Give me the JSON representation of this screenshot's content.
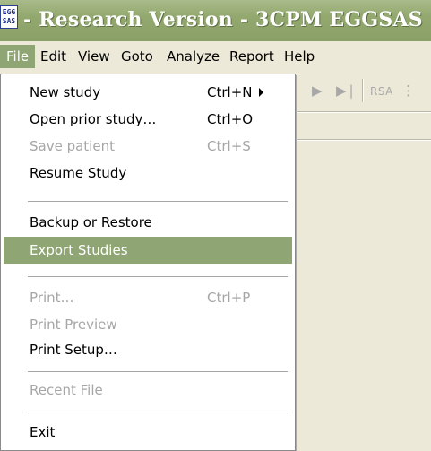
{
  "window": {
    "logo_line1": "EGG",
    "logo_line2": "SAS",
    "title": "- Research Version - 3CPM EGGSAS"
  },
  "menubar": {
    "items": [
      "File",
      "Edit",
      "View",
      "Goto",
      "Analyze",
      "Report",
      "Help"
    ],
    "active": "File"
  },
  "toolbar": {
    "rsa_label": "RSA"
  },
  "file_menu": {
    "new_study": {
      "label": "New study",
      "shortcut": "Ctrl+N"
    },
    "open_prior_study": {
      "label": "Open prior study…",
      "shortcut": "Ctrl+O"
    },
    "save_patient": {
      "label": "Save patient",
      "shortcut": "Ctrl+S",
      "disabled": true
    },
    "resume_study": {
      "label": "Resume Study"
    },
    "backup_restore": {
      "label": "Backup or Restore"
    },
    "export_studies": {
      "label": "Export Studies",
      "selected": true
    },
    "print": {
      "label": "Print…",
      "shortcut": "Ctrl+P",
      "disabled": true
    },
    "print_preview": {
      "label": "Print Preview",
      "disabled": true
    },
    "print_setup": {
      "label": "Print Setup…"
    },
    "recent_file": {
      "label": "Recent File",
      "disabled": true
    },
    "exit": {
      "label": "Exit"
    }
  },
  "colors": {
    "titlebar": "#93a86f",
    "highlight": "#8fa574",
    "menubar_bg": "#ECE9D8",
    "disabled_text": "#a6a6a6"
  }
}
